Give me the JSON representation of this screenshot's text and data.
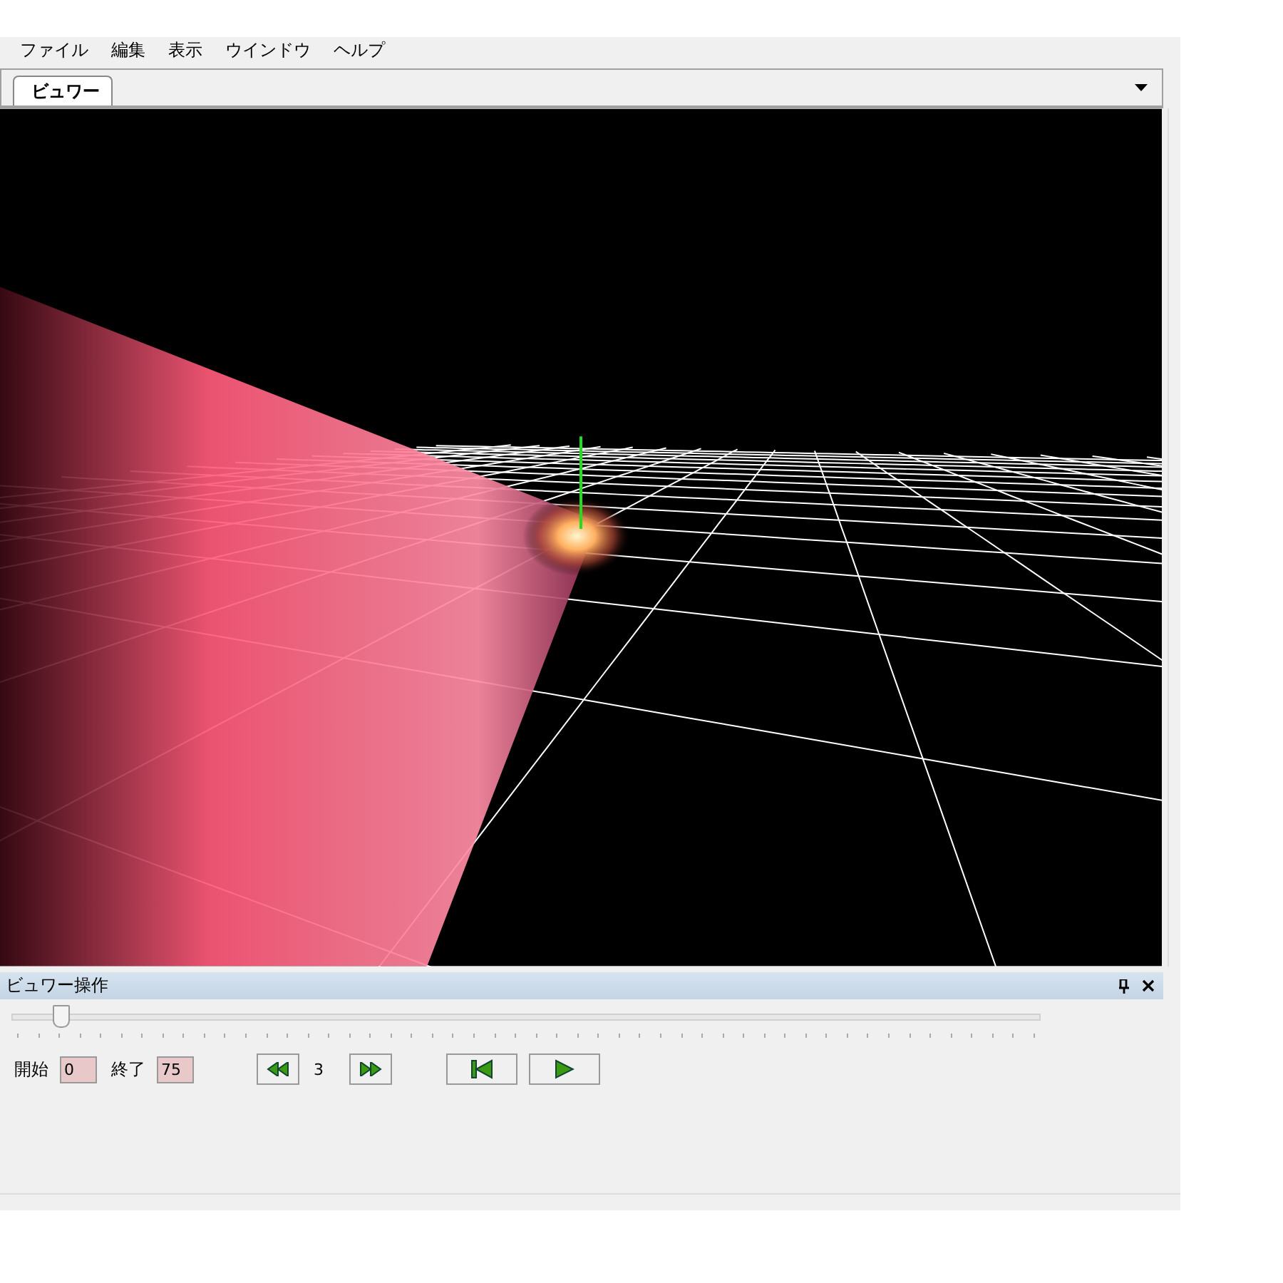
{
  "menu": [
    "ファイル",
    "編集",
    "表示",
    "ウインドウ",
    "ヘルプ"
  ],
  "tabs": [
    {
      "label": "ビュワー",
      "selected": true
    }
  ],
  "viewer_panel": {
    "title": "ビュワー操作",
    "slider": {
      "level": 0.04
    },
    "start_label": "開始",
    "start_value": "0",
    "end_label": "終了",
    "end_value": "75",
    "frame": "3"
  }
}
